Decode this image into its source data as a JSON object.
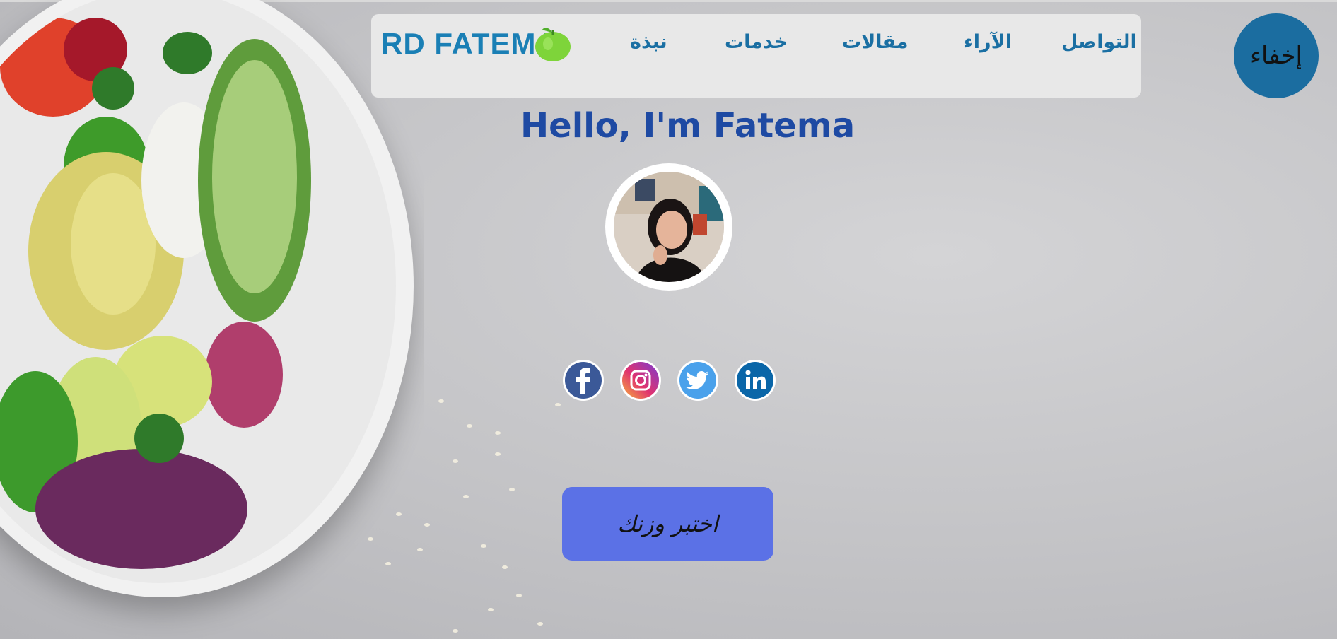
{
  "brand": {
    "name": "RD FATEMA",
    "logo_icon": "green-apple-icon"
  },
  "nav": {
    "items": [
      {
        "label": "التواصل"
      },
      {
        "label": "الآراء"
      },
      {
        "label": "مقالات"
      },
      {
        "label": "خدمات"
      },
      {
        "label": "نبذة"
      }
    ]
  },
  "hide_button": {
    "label": "إخفاء"
  },
  "hero": {
    "headline": "Hello, I'm Fatema",
    "cta_label": "اختبر وزنك"
  },
  "social": [
    {
      "name": "facebook-icon"
    },
    {
      "name": "instagram-icon"
    },
    {
      "name": "twitter-icon"
    },
    {
      "name": "linkedin-icon"
    }
  ],
  "colors": {
    "nav_text": "#1a6fa3",
    "brand": "#1a7fb5",
    "hide_button_bg": "#1b6da0",
    "headline": "#1e4aa3",
    "cta_bg": "#5b71e6"
  }
}
